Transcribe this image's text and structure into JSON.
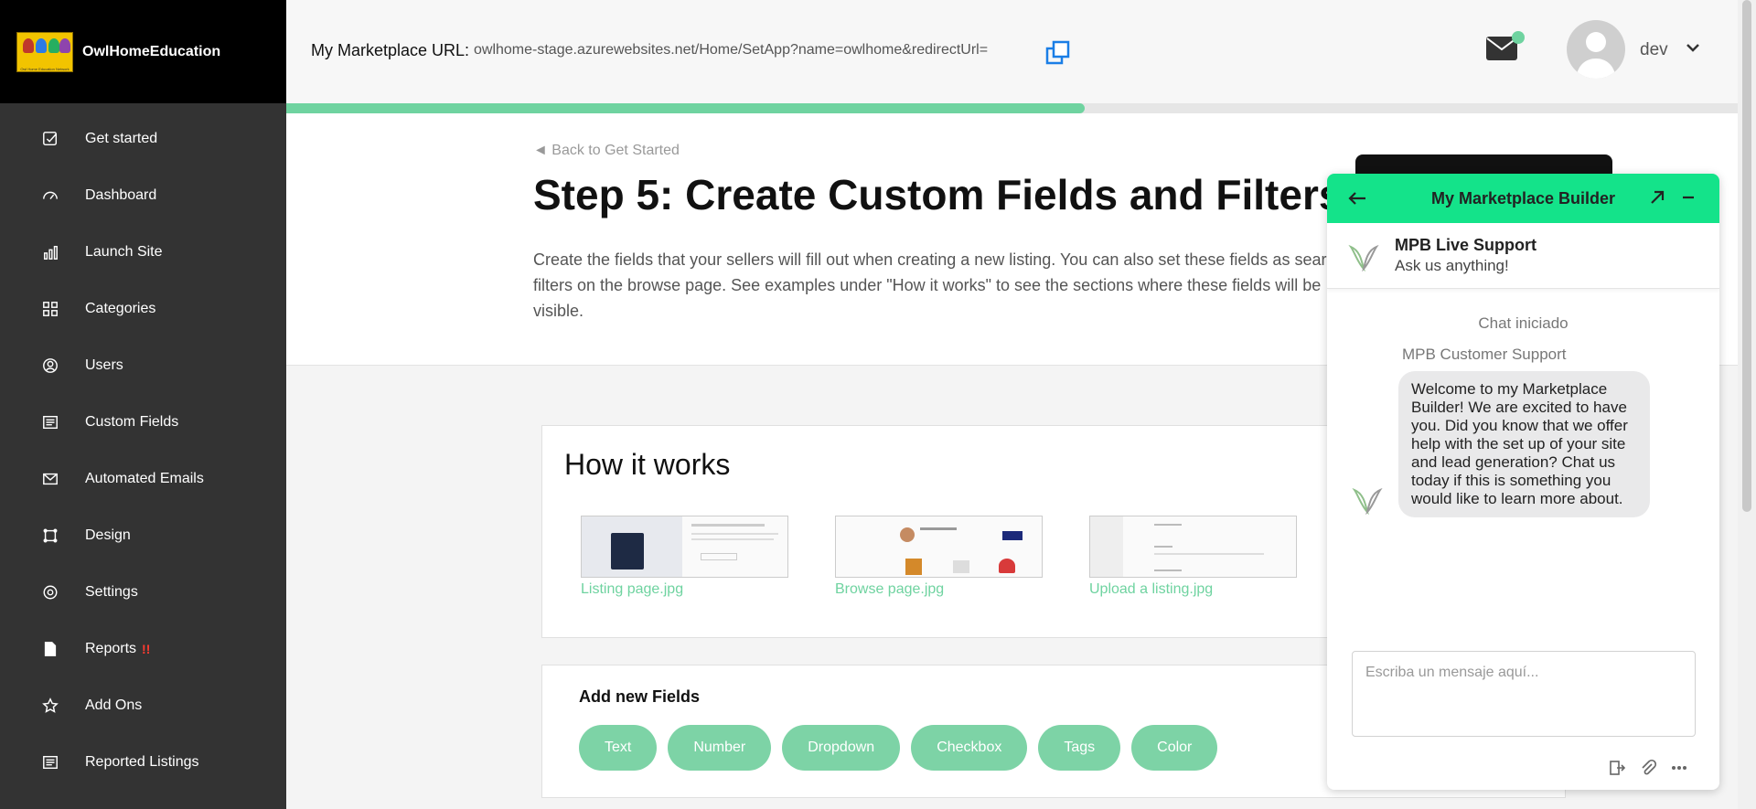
{
  "brand": {
    "name": "OwlHomeEducation",
    "logo_caption": "Owl Home Education Network"
  },
  "sidebar": {
    "items": [
      {
        "label": "Get started",
        "icon": "checkbox-icon"
      },
      {
        "label": "Dashboard",
        "icon": "gauge-icon"
      },
      {
        "label": "Launch Site",
        "icon": "bar-chart-icon"
      },
      {
        "label": "Categories",
        "icon": "grid-icon"
      },
      {
        "label": "Users",
        "icon": "user-circle-icon"
      },
      {
        "label": "Custom Fields",
        "icon": "list-icon"
      },
      {
        "label": "Automated Emails",
        "icon": "envelope-icon"
      },
      {
        "label": "Design",
        "icon": "crop-icon"
      },
      {
        "label": "Settings",
        "icon": "gear-icon"
      },
      {
        "label": "Reports",
        "icon": "document-icon",
        "badge": "!!"
      },
      {
        "label": "Add Ons",
        "icon": "star-icon"
      },
      {
        "label": "Reported Listings",
        "icon": "list-icon"
      }
    ]
  },
  "topbar": {
    "url_label": "My Marketplace URL:",
    "url_value": "owlhome-stage.azurewebsites.net/Home/SetApp?name=owlhome&redirectUrl=",
    "user_name": "dev",
    "progress_fraction": 0.55
  },
  "step": {
    "back_link": "◄ Back to Get Started",
    "title_prefix": "Step 5:",
    "title": "Create Custom Fields and Filters",
    "description": "Create the fields that your sellers will fill out when creating a new listing. You can also set these fields as search filters on the browse page. See examples under \"How it works\" to see the sections where these fields will be visible."
  },
  "how_it_works": {
    "title": "How it works",
    "images": [
      {
        "caption": "Listing page.jpg"
      },
      {
        "caption": "Browse page.jpg"
      },
      {
        "caption": "Upload a listing.jpg"
      }
    ]
  },
  "add_fields": {
    "title": "Add new Fields",
    "types": [
      "Text",
      "Number",
      "Dropdown",
      "Checkbox",
      "Tags",
      "Color"
    ]
  },
  "chat": {
    "header_title": "My Marketplace Builder",
    "agent_name": "MPB Live Support",
    "agent_sub": "Ask us anything!",
    "started_text": "Chat iniciado",
    "sender": "MPB Customer Support",
    "message": "Welcome to my Marketplace Builder! We are excited to have you. Did you know that we offer help with the set up of your site and lead generation? Chat us today if this is something you would like to learn more about.",
    "input_placeholder": "Escriba un mensaje aquí...",
    "accent_color": "#14e38a"
  },
  "colors": {
    "accent": "#6fd3a0",
    "sidebar_bg": "#333333"
  }
}
